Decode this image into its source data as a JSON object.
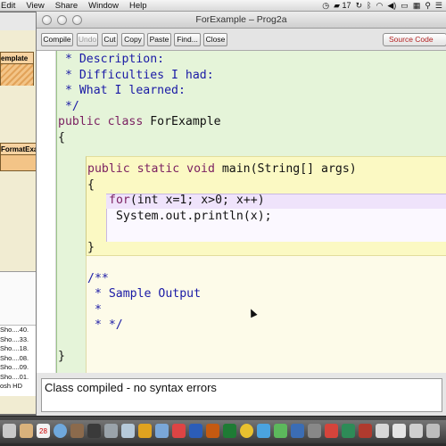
{
  "menubar": {
    "items": [
      "Edit",
      "View",
      "Share",
      "Window",
      "Help"
    ],
    "status_number": "17"
  },
  "bg_window": {
    "class1_label": "emplate",
    "class2_label": "FormatExam",
    "list_rows": [
      "Sho....40.",
      "Sho....33.",
      "Sho....18.",
      "Sho....08.",
      "Sho....09.",
      "Sho....01.",
      "osh HD"
    ]
  },
  "window": {
    "title": "ForExample – Prog2a"
  },
  "toolbar": {
    "compile": "Compile",
    "undo": "Undo",
    "cut": "Cut",
    "copy": "Copy",
    "paste": "Paste",
    "find": "Find...",
    "close": "Close",
    "view_mode": "Source Code"
  },
  "code": {
    "line_description": " * Description:",
    "line_difficulties": " * Difficulties I had:",
    "line_learned": " * What I learned:",
    "line_end_comment": " */",
    "class_kw": "public class",
    "class_name": " ForExample",
    "open_brace_class": "{",
    "main_kw": "public static void",
    "main_sig": " main(String[] args)",
    "open_brace_main": "{",
    "for_kw": "for",
    "for_cond": "(int x=1; x>0; x++)",
    "println": " System.out.println(x);",
    "close_brace_main": "}",
    "javadoc_open": "/**",
    "sample_output": " * Sample Output",
    "star_line": " *",
    "javadoc_close": " * */",
    "close_brace_class": "}"
  },
  "status": {
    "message": "Class compiled - no syntax errors"
  },
  "dock": {
    "calendar_day": "28"
  },
  "colors": {
    "class_scope": "#e5f4d9",
    "method_scope": "#fbf9c3",
    "loop_scope": "#efe3fb",
    "comment": "#1a1aa6",
    "keyword": "#7a1f60",
    "view_mode_text": "#b22222"
  }
}
